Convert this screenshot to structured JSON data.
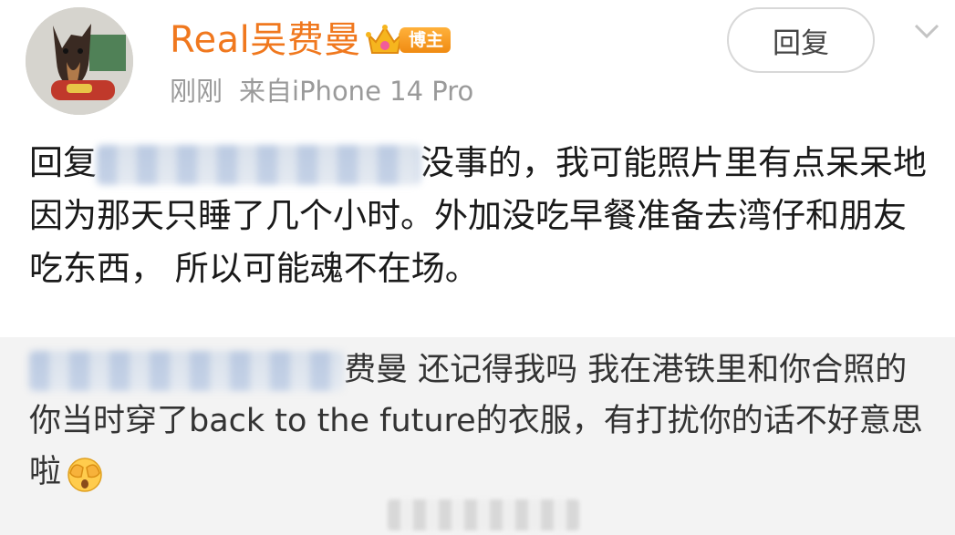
{
  "post": {
    "username": "Real吴费曼",
    "badge_label": "博主",
    "time": "刚刚",
    "source": "来自iPhone 14 Pro",
    "reply_button_label": "回复",
    "comment_prefix": "回复",
    "comment_text": "没事的，我可能照片里有点呆呆地因为那天只睡了几个小时。外加没吃早餐准备去湾仔和朋友吃东西， 所以可能魂不在场。"
  },
  "quoted": {
    "text": "费曼 还记得我吗 我在港铁里和你合照的 你当时穿了back to the future的衣服，有打扰你的话不好意思啦",
    "emoji": "face-with-hands-over-eyes"
  },
  "colors": {
    "username": "#f0781e",
    "meta": "#9a9a9a",
    "quoted_bg": "#f3f3f3"
  }
}
